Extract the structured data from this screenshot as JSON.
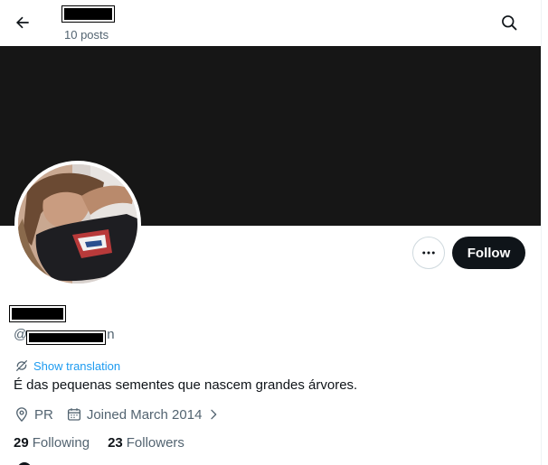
{
  "header": {
    "post_count": "10 posts",
    "back_icon": "arrow-left-icon",
    "search_icon": "search-icon"
  },
  "profile": {
    "handle_prefix": "@",
    "handle_suffix": "n",
    "show_translation": "Show translation",
    "bio": "É das pequenas sementes que nascem grandes árvores.",
    "location": "PR",
    "joined": "Joined March 2014",
    "following_count": "29",
    "following_label": "Following",
    "followers_count": "23",
    "followers_label": "Followers"
  },
  "actions": {
    "follow_label": "Follow",
    "more_icon": "more-horizontal-icon"
  },
  "colors": {
    "accent": "#1d9bf0",
    "text": "#0f1419",
    "muted": "#536471",
    "banner": "#161616"
  }
}
